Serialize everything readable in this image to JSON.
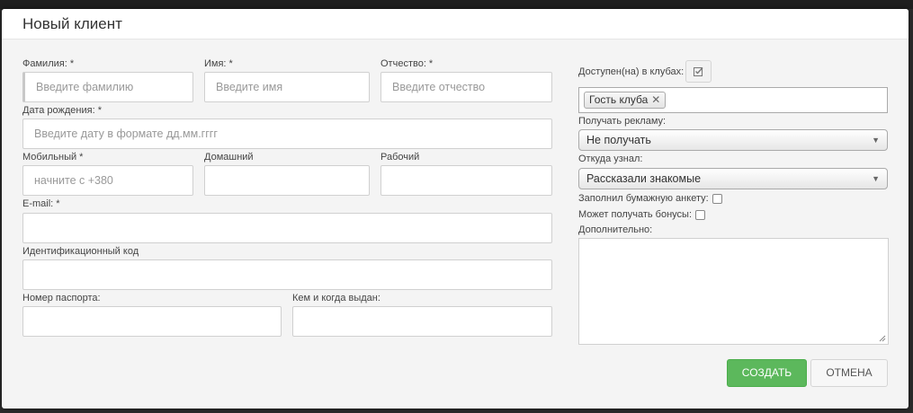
{
  "modal": {
    "title": "Новый клиент"
  },
  "fields": {
    "last_name": {
      "label": "Фамилия: *",
      "placeholder": "Введите фамилию"
    },
    "first_name": {
      "label": "Имя: *",
      "placeholder": "Введите имя"
    },
    "patronymic": {
      "label": "Отчество: *",
      "placeholder": "Введите отчество"
    },
    "birth_date": {
      "label": "Дата рождения: *",
      "placeholder": "Введите дату в формате дд.мм.гггг"
    },
    "mobile": {
      "label": "Мобильный *",
      "placeholder": "начните с +380"
    },
    "home_phone": {
      "label": "Домашний",
      "placeholder": ""
    },
    "work_phone": {
      "label": "Рабочий",
      "placeholder": ""
    },
    "email": {
      "label": "E-mail: *",
      "placeholder": ""
    },
    "id_code": {
      "label": "Идентификационный код",
      "placeholder": ""
    },
    "passport": {
      "label": "Номер паспорта:",
      "placeholder": ""
    },
    "issued_by": {
      "label": "Кем и когда выдан:",
      "placeholder": ""
    }
  },
  "right": {
    "clubs_label": "Доступен(на) в клубах:",
    "clubs_icon": "check-square-icon",
    "clubs_tags": [
      "Гость клуба"
    ],
    "ads": {
      "label": "Получать рекламу:",
      "value": "Не получать"
    },
    "source": {
      "label": "Откуда узнал:",
      "value": "Рассказали знакомые"
    },
    "paper_form": {
      "label": "Заполнил бумажную анкету:",
      "checked": false
    },
    "bonuses": {
      "label": "Может получать бонусы:",
      "checked": false
    },
    "extra": {
      "label": "Дополнительно:"
    }
  },
  "buttons": {
    "create": "Создать",
    "cancel": "Отмена"
  }
}
